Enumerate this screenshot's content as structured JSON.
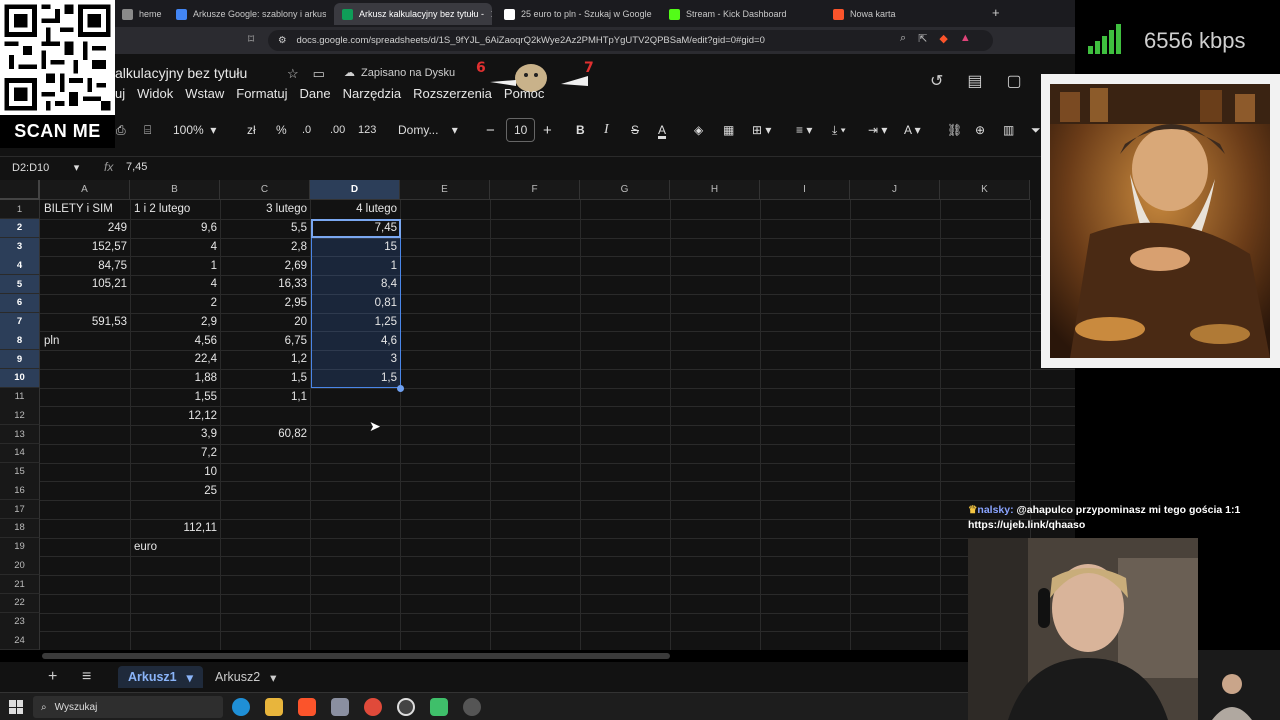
{
  "browser": {
    "tabs": [
      {
        "title": "heme - Ext",
        "color": "#8a8a8a",
        "active": false
      },
      {
        "title": "Arkusze Google: szablony i arkusze k",
        "color": "#4285f4",
        "active": false
      },
      {
        "title": "Arkusz kalkulacyjny bez tytułu - ",
        "color": "#0f9d58",
        "active": true
      },
      {
        "title": "25 euro to pln - Szukaj w Google",
        "color": "#ffffff",
        "active": false
      },
      {
        "title": "Stream - Kick Dashboard",
        "color": "#53fc18",
        "active": false
      },
      {
        "title": "Nowa karta",
        "color": "#fb542b",
        "active": false
      }
    ],
    "new_tab": "+",
    "url": "docs.google.com/spreadsheets/d/1S_9fYJL_6AiZaoqrQ2kWye2Az2PMHTpYgUTV2QPBSaM/edit?gid=0#gid=0"
  },
  "sheets": {
    "title": "alkulacyjny bez tytułu",
    "saved_status": "Zapisano na Dysku",
    "menu": [
      "uj",
      "Widok",
      "Wstaw",
      "Formatuj",
      "Dane",
      "Narzędzia",
      "Rozszerzenia",
      "Pomoc"
    ],
    "toolbar": {
      "zoom": "100%",
      "currency": "zł",
      "percent": "%",
      "dec_decrease": ".0",
      "dec_increase": ".00",
      "format": "123",
      "font": "Domy...",
      "font_size": "10",
      "bold": "B",
      "italic": "I",
      "strike": "S",
      "text_color": "A"
    },
    "name_box": "D2:D10",
    "formula": "7,45",
    "columns": [
      "A",
      "B",
      "C",
      "D",
      "E",
      "F",
      "G",
      "H",
      "I",
      "J",
      "K"
    ],
    "rows": [
      "1",
      "2",
      "3",
      "4",
      "5",
      "6",
      "7",
      "8",
      "9",
      "10",
      "11",
      "12",
      "13",
      "14",
      "15",
      "16",
      "17",
      "18",
      "19",
      "20",
      "21",
      "22",
      "23",
      "24"
    ],
    "cells": [
      {
        "r": 1,
        "c": "A",
        "v": "BILETY i SIM",
        "t": "txt"
      },
      {
        "r": 1,
        "c": "B",
        "v": "1 i 2 lutego",
        "t": "txt"
      },
      {
        "r": 1,
        "c": "C",
        "v": "3 lutego",
        "t": "num"
      },
      {
        "r": 1,
        "c": "D",
        "v": "4 lutego",
        "t": "num"
      },
      {
        "r": 2,
        "c": "A",
        "v": "249",
        "t": "num"
      },
      {
        "r": 2,
        "c": "B",
        "v": "9,6",
        "t": "num"
      },
      {
        "r": 2,
        "c": "C",
        "v": "5,5",
        "t": "num"
      },
      {
        "r": 2,
        "c": "D",
        "v": "7,45",
        "t": "num"
      },
      {
        "r": 3,
        "c": "A",
        "v": "152,57",
        "t": "num"
      },
      {
        "r": 3,
        "c": "B",
        "v": "4",
        "t": "num"
      },
      {
        "r": 3,
        "c": "C",
        "v": "2,8",
        "t": "num"
      },
      {
        "r": 3,
        "c": "D",
        "v": "15",
        "t": "num"
      },
      {
        "r": 4,
        "c": "A",
        "v": "84,75",
        "t": "num"
      },
      {
        "r": 4,
        "c": "B",
        "v": "1",
        "t": "num"
      },
      {
        "r": 4,
        "c": "C",
        "v": "2,69",
        "t": "num"
      },
      {
        "r": 4,
        "c": "D",
        "v": "1",
        "t": "num"
      },
      {
        "r": 5,
        "c": "A",
        "v": "105,21",
        "t": "num"
      },
      {
        "r": 5,
        "c": "B",
        "v": "4",
        "t": "num"
      },
      {
        "r": 5,
        "c": "C",
        "v": "16,33",
        "t": "num"
      },
      {
        "r": 5,
        "c": "D",
        "v": "8,4",
        "t": "num"
      },
      {
        "r": 6,
        "c": "B",
        "v": "2",
        "t": "num"
      },
      {
        "r": 6,
        "c": "C",
        "v": "2,95",
        "t": "num"
      },
      {
        "r": 6,
        "c": "D",
        "v": "0,81",
        "t": "num"
      },
      {
        "r": 7,
        "c": "A",
        "v": "591,53",
        "t": "num"
      },
      {
        "r": 7,
        "c": "B",
        "v": "2,9",
        "t": "num"
      },
      {
        "r": 7,
        "c": "C",
        "v": "20",
        "t": "num"
      },
      {
        "r": 7,
        "c": "D",
        "v": "1,25",
        "t": "num"
      },
      {
        "r": 8,
        "c": "A",
        "v": "pln",
        "t": "txt"
      },
      {
        "r": 8,
        "c": "B",
        "v": "4,56",
        "t": "num"
      },
      {
        "r": 8,
        "c": "C",
        "v": "6,75",
        "t": "num"
      },
      {
        "r": 8,
        "c": "D",
        "v": "4,6",
        "t": "num"
      },
      {
        "r": 9,
        "c": "B",
        "v": "22,4",
        "t": "num"
      },
      {
        "r": 9,
        "c": "C",
        "v": "1,2",
        "t": "num"
      },
      {
        "r": 9,
        "c": "D",
        "v": "3",
        "t": "num"
      },
      {
        "r": 10,
        "c": "B",
        "v": "1,88",
        "t": "num"
      },
      {
        "r": 10,
        "c": "C",
        "v": "1,5",
        "t": "num"
      },
      {
        "r": 10,
        "c": "D",
        "v": "1,5",
        "t": "num"
      },
      {
        "r": 11,
        "c": "B",
        "v": "1,55",
        "t": "num"
      },
      {
        "r": 11,
        "c": "C",
        "v": "1,1",
        "t": "num"
      },
      {
        "r": 12,
        "c": "B",
        "v": "12,12",
        "t": "num"
      },
      {
        "r": 13,
        "c": "B",
        "v": "3,9",
        "t": "num"
      },
      {
        "r": 13,
        "c": "C",
        "v": "60,82",
        "t": "num"
      },
      {
        "r": 14,
        "c": "B",
        "v": "7,2",
        "t": "num"
      },
      {
        "r": 15,
        "c": "B",
        "v": "10",
        "t": "num"
      },
      {
        "r": 16,
        "c": "B",
        "v": "25",
        "t": "num"
      },
      {
        "r": 18,
        "c": "B",
        "v": "112,11",
        "t": "num"
      },
      {
        "r": 19,
        "c": "B",
        "v": "euro",
        "t": "txt"
      }
    ],
    "sheet_tabs": [
      {
        "label": "Arkusz1",
        "active": true
      },
      {
        "label": "Arkusz2",
        "active": false
      }
    ]
  },
  "overlay": {
    "scan_label": "SCAN ME",
    "bitrate": "6556 kbps",
    "chat_user": "nalsky:",
    "chat_message": "@ahapulco przypominasz mi tego gościa 1:1",
    "chat_link": "https://ujeb.link/qhaaso",
    "accent": "#4a86e8"
  },
  "taskbar": {
    "search_placeholder": "Wyszukaj"
  }
}
